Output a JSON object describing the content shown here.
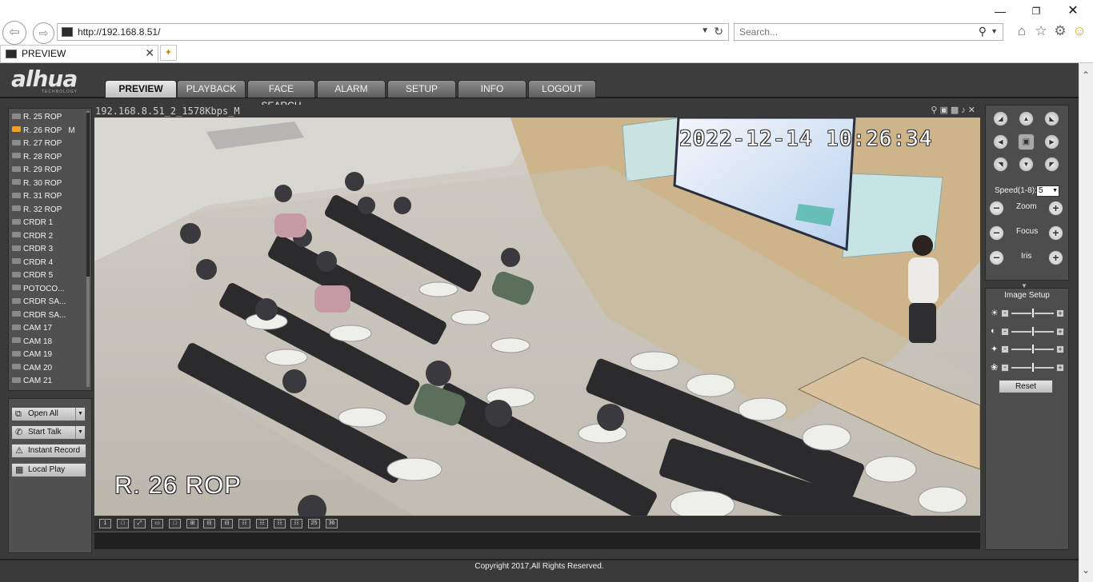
{
  "browser": {
    "url": "http://192.168.8.51/",
    "search_placeholder": "Search...",
    "tab_title": "PREVIEW",
    "window_controls": [
      "minimize-icon",
      "restore-icon",
      "close-icon"
    ],
    "toolbar_icons": [
      "home-icon",
      "star-icon",
      "gear-icon",
      "smiley-icon"
    ]
  },
  "app": {
    "logo": "alhua",
    "logo_sub": "TECHNOLOGY",
    "nav": [
      "PREVIEW",
      "PLAYBACK",
      "FACE SEARCH",
      "ALARM",
      "SETUP",
      "INFO",
      "LOGOUT"
    ],
    "active_nav": "PREVIEW"
  },
  "channels": [
    {
      "label": "R. 25 ROP",
      "selected": false,
      "marker": ""
    },
    {
      "label": "R. 26 ROP",
      "selected": true,
      "marker": "M"
    },
    {
      "label": "R. 27 ROP",
      "selected": false,
      "marker": ""
    },
    {
      "label": "R. 28 ROP",
      "selected": false,
      "marker": ""
    },
    {
      "label": "R. 29 ROP",
      "selected": false,
      "marker": ""
    },
    {
      "label": "R. 30 ROP",
      "selected": false,
      "marker": ""
    },
    {
      "label": "R. 31 ROP",
      "selected": false,
      "marker": ""
    },
    {
      "label": "R. 32 ROP",
      "selected": false,
      "marker": ""
    },
    {
      "label": "CRDR 1",
      "selected": false,
      "marker": ""
    },
    {
      "label": "CRDR 2",
      "selected": false,
      "marker": ""
    },
    {
      "label": "CRDR 3",
      "selected": false,
      "marker": ""
    },
    {
      "label": "CRDR 4",
      "selected": false,
      "marker": ""
    },
    {
      "label": "CRDR 5",
      "selected": false,
      "marker": ""
    },
    {
      "label": "POTOCO...",
      "selected": false,
      "marker": ""
    },
    {
      "label": "CRDR SA...",
      "selected": false,
      "marker": ""
    },
    {
      "label": "CRDR SA...",
      "selected": false,
      "marker": ""
    },
    {
      "label": "CAM 17",
      "selected": false,
      "marker": ""
    },
    {
      "label": "CAM 18",
      "selected": false,
      "marker": ""
    },
    {
      "label": "CAM 19",
      "selected": false,
      "marker": ""
    },
    {
      "label": "CAM 20",
      "selected": false,
      "marker": ""
    },
    {
      "label": "CAM 21",
      "selected": false,
      "marker": ""
    }
  ],
  "controls": {
    "open_all": "Open All",
    "start_talk": "Start Talk",
    "instant_record": "Instant Record",
    "local_play": "Local Play"
  },
  "video": {
    "stream_title": "192.168.8.51_2_1578Kbps_M",
    "osd_timestamp": "2022-12-14 10:26:34",
    "osd_channel": "R. 26 ROP",
    "layout_buttons": [
      "1",
      "□",
      "⤢",
      "▭",
      "□",
      "⊞",
      "⊟",
      "⊟",
      "☷",
      "☷",
      "☷",
      "☷",
      "25",
      "36"
    ]
  },
  "ptz": {
    "speed_label": "Speed(1-8):",
    "speed_value": "5",
    "zoom_label": "Zoom",
    "focus_label": "Focus",
    "iris_label": "Iris"
  },
  "image_setup": {
    "title": "Image Setup",
    "rows": [
      {
        "icon": "brightness-icon",
        "level": 0.5
      },
      {
        "icon": "contrast-icon",
        "level": 0.5
      },
      {
        "icon": "saturation-icon",
        "level": 0.5
      },
      {
        "icon": "hue-icon",
        "level": 0.5
      }
    ],
    "reset_label": "Reset"
  },
  "footer": {
    "copyright": "Copyright 2017,All Rights Reserved."
  }
}
